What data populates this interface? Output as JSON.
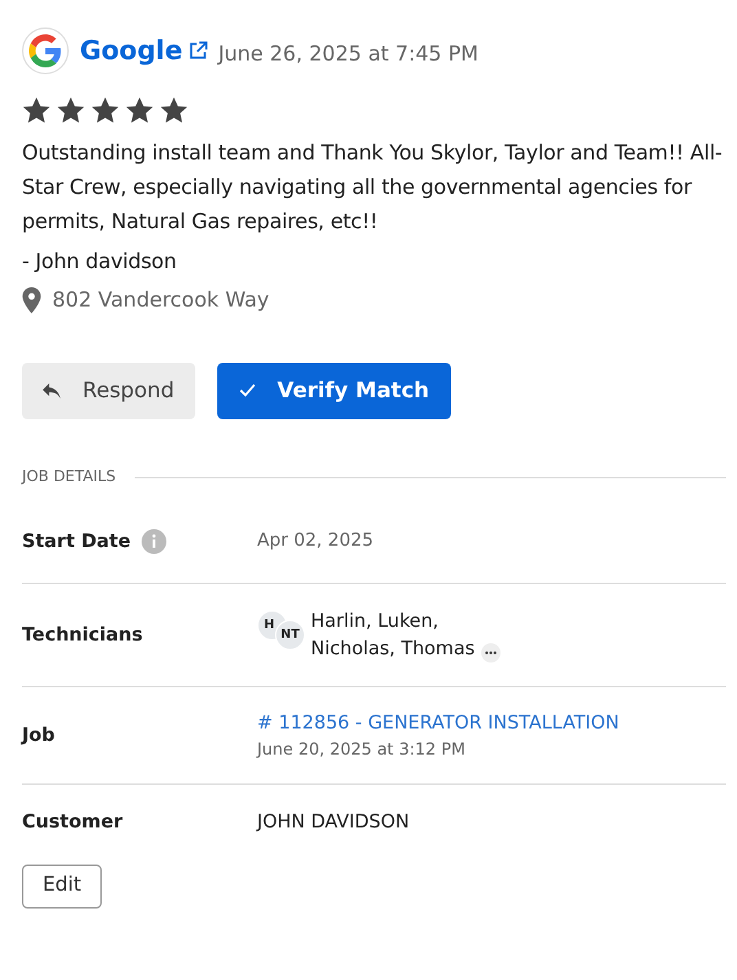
{
  "review": {
    "source": "Google",
    "date": "June 26, 2025 at 7:45 PM",
    "stars": 5,
    "text": "Outstanding install team and Thank You Skylor, Taylor and Team!! All-Star Crew, especially navigating all the governmental agencies for permits, Natural Gas repaires, etc!!",
    "author": "- John davidson",
    "address": "802 Vandercook Way"
  },
  "actions": [
    {
      "kind": "respond",
      "label": "Respond"
    },
    {
      "kind": "verify",
      "label": "Verify Match"
    }
  ],
  "job_details": {
    "heading": "JOB DETAILS",
    "rows": [
      {
        "kind": "date",
        "label": "Start Date",
        "value": "Apr 02, 2025"
      },
      {
        "kind": "technicians",
        "label": "Technicians",
        "avatars": [
          "H",
          "NT"
        ],
        "value": "Harlin, Luken, Nicholas, Thomas"
      },
      {
        "kind": "job",
        "label": "Job",
        "value": "# 112856 - GENERATOR INSTALLATION",
        "sub": "June 20, 2025 at 3:12 PM"
      },
      {
        "kind": "customer",
        "label": "Customer",
        "value": "JOHN DAVIDSON"
      }
    ]
  },
  "edit_button": "Edit"
}
